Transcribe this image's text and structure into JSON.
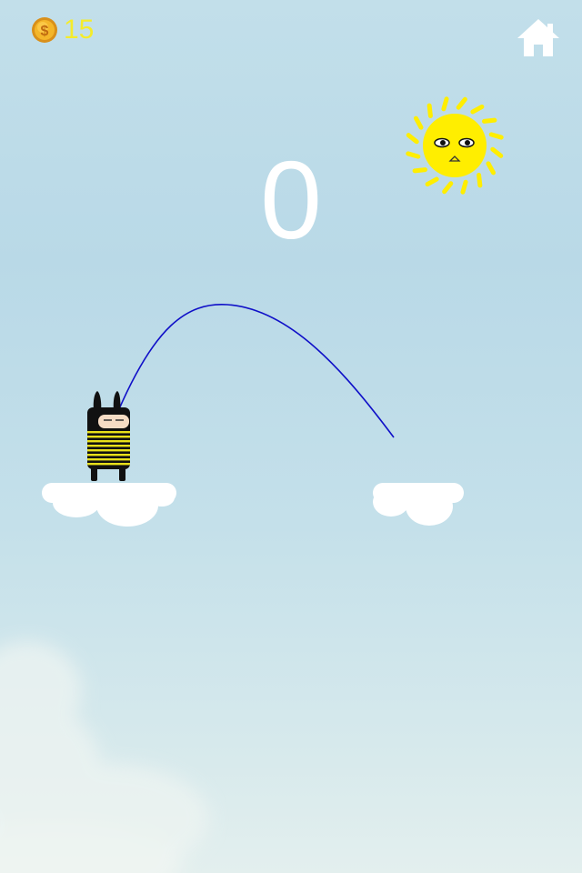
{
  "hud": {
    "coin_icon": "gold-coin-icon",
    "coin_count": "15",
    "home_icon": "home-icon",
    "score": "0"
  },
  "colors": {
    "coin_text": "#f5ec2a",
    "sun": "#ffee00",
    "trajectory": "#1010c8",
    "player_stripes": "#e8e01a",
    "cloud": "#ffffff",
    "sky_top": "#c2dfea"
  },
  "scene": {
    "player": "striped-ninja-character",
    "sun": "sun-with-face",
    "platforms": [
      "left-cloud-platform",
      "right-cloud-platform"
    ],
    "trajectory": "jump-arc-preview"
  }
}
